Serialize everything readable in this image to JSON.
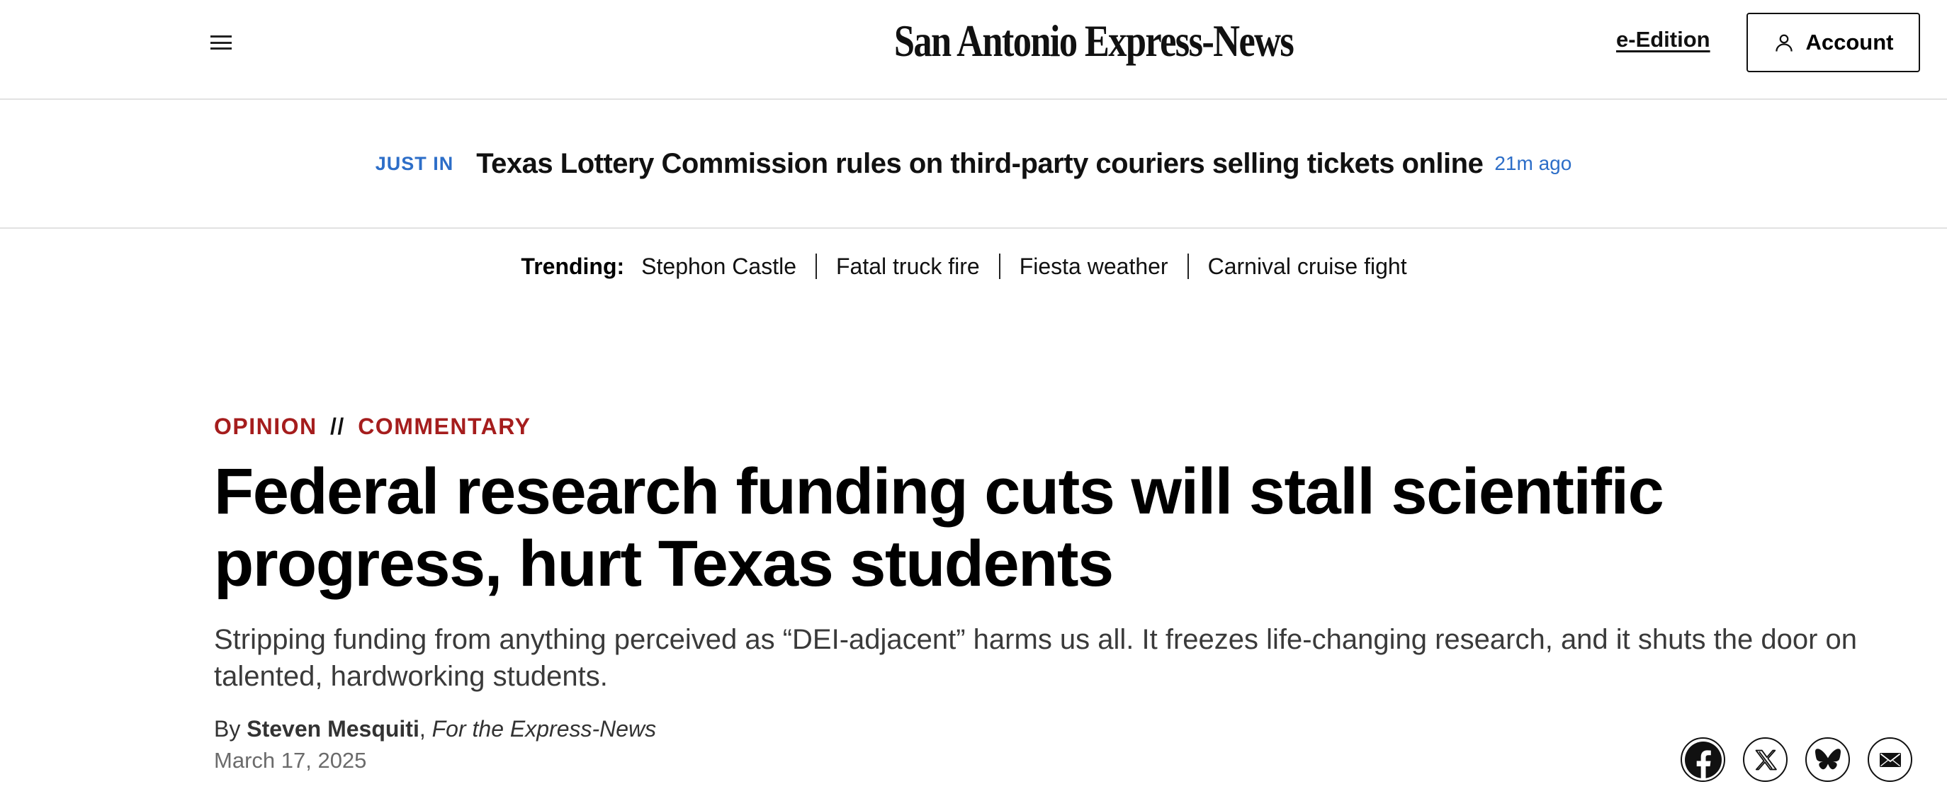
{
  "header": {
    "menu_icon": "hamburger-menu-icon",
    "logo_text": "San Antonio Express-News",
    "eedition_label": "e-Edition",
    "account_label": "Account",
    "account_icon": "user-icon"
  },
  "just_in": {
    "label": "JUST IN",
    "headline": "Texas Lottery Commission rules on third-party couriers selling tickets online",
    "time": "21m ago"
  },
  "trending": {
    "label": "Trending:",
    "items": [
      "Stephon Castle",
      "Fatal truck fire",
      "Fiesta weather",
      "Carnival cruise fight"
    ]
  },
  "article": {
    "section_primary": "OPINION",
    "section_separator": "//",
    "section_secondary": "COMMENTARY",
    "headline": "Federal research funding cuts will stall scientific progress, hurt Texas students",
    "dek": "Stripping funding from anything perceived as “DEI-adjacent” harms us all. It freezes life-changing research, and it shuts the door on talented, hardworking students.",
    "byline_prefix": "By",
    "author": "Steven Mesquiti",
    "byline_comma": ",",
    "affiliation": "For the Express-News",
    "date": "March 17, 2025"
  },
  "share": {
    "icons": [
      "facebook-icon",
      "x-icon",
      "bluesky-icon",
      "email-icon"
    ]
  },
  "colors": {
    "accent_blue": "#2d6ec8",
    "section_red": "#a51d1d",
    "text": "#111111",
    "muted": "#6b6b6b"
  }
}
